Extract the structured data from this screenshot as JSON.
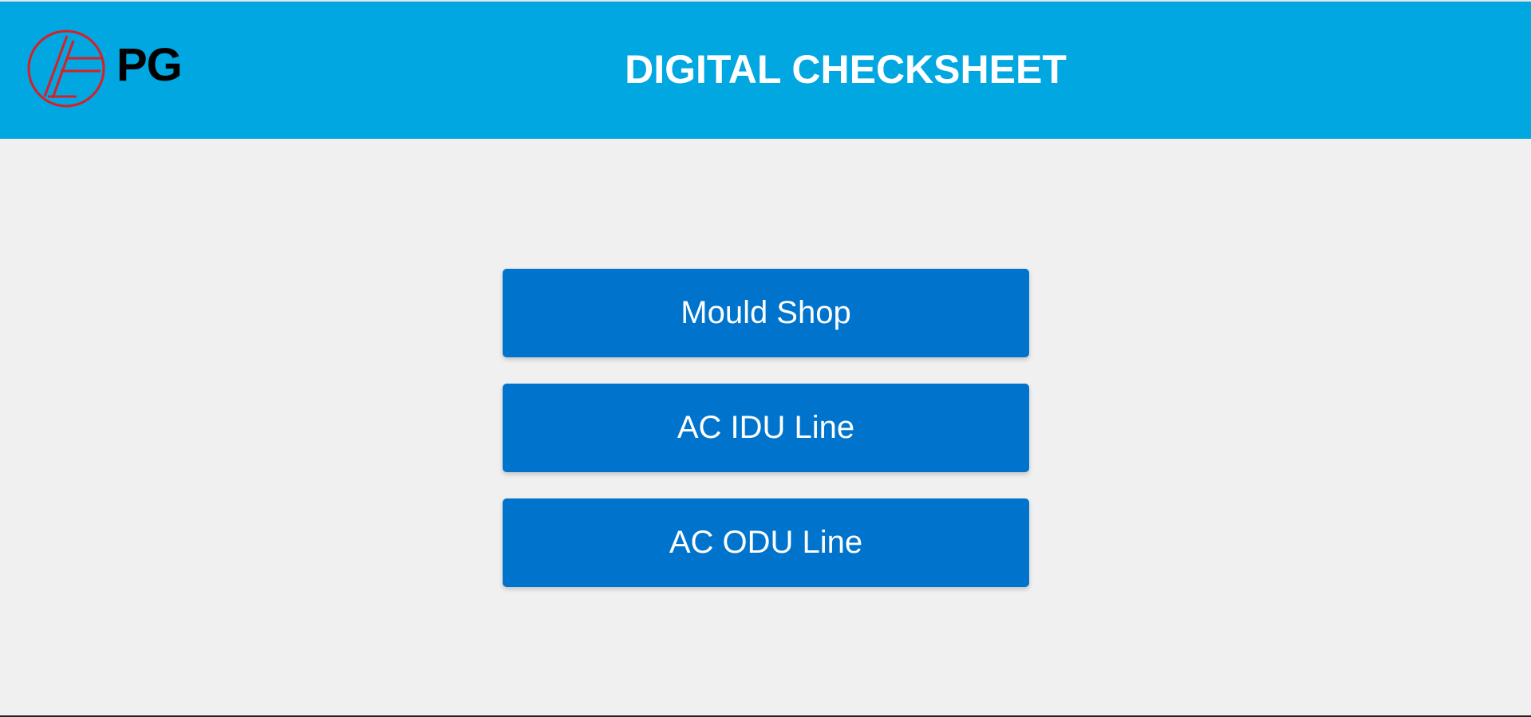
{
  "header": {
    "logo_text": "PG",
    "title": "DIGITAL CHECKSHEET"
  },
  "menu": {
    "items": [
      {
        "label": "Mould Shop"
      },
      {
        "label": "AC IDU Line"
      },
      {
        "label": "AC ODU Line"
      }
    ]
  },
  "colors": {
    "header_bg": "#00a7e1",
    "button_bg": "#0074cc",
    "page_bg": "#f0f0f0",
    "logo_red": "#d81f26"
  },
  "icons": {
    "logo": "pg-logo-icon"
  }
}
